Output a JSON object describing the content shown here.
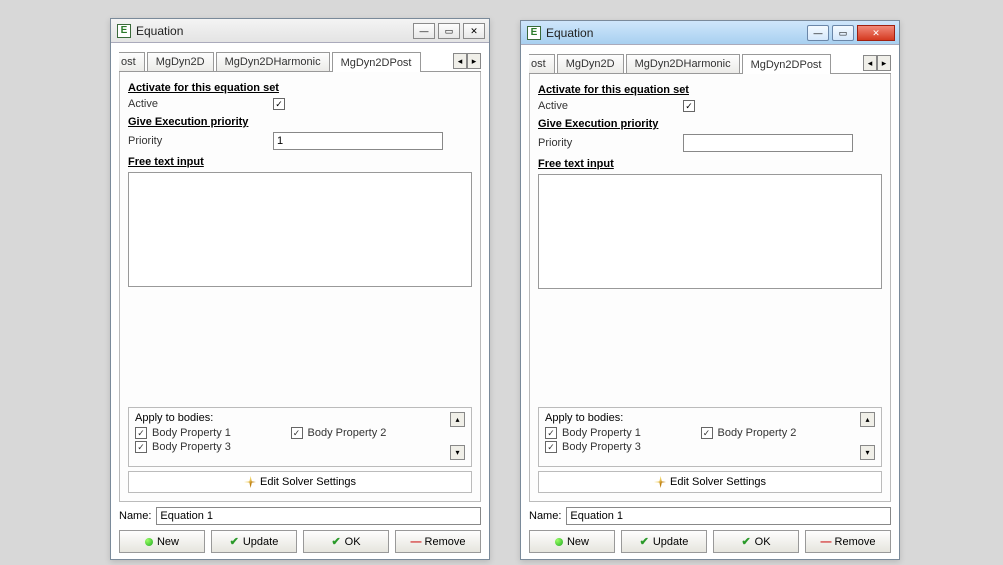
{
  "left": {
    "title": "Equation",
    "tabs": {
      "partial": "ost",
      "t1": "MgDyn2D",
      "t2": "MgDyn2DHarmonic",
      "t3": "MgDyn2DPost"
    },
    "sections": {
      "activate": "Activate for this equation set",
      "activeLabel": "Active",
      "execPriority": "Give Execution priority",
      "priorityLabel": "Priority",
      "priorityValue": "1",
      "freeText": "Free text input"
    },
    "apply": {
      "title": "Apply to bodies:",
      "b1": "Body Property 1",
      "b2": "Body Property 2",
      "b3": "Body Property 3"
    },
    "editSolver": "Edit Solver Settings",
    "nameLabel": "Name:",
    "nameValue": "Equation 1",
    "buttons": {
      "new": "New",
      "update": "Update",
      "ok": "OK",
      "remove": "Remove"
    }
  },
  "right": {
    "title": "Equation",
    "tabs": {
      "partial": "ost",
      "t1": "MgDyn2D",
      "t2": "MgDyn2DHarmonic",
      "t3": "MgDyn2DPost"
    },
    "sections": {
      "activate": "Activate for this equation set",
      "activeLabel": "Active",
      "execPriority": "Give Execution priority",
      "priorityLabel": "Priority",
      "priorityValue": "",
      "freeText": "Free text input"
    },
    "apply": {
      "title": "Apply to bodies:",
      "b1": "Body Property 1",
      "b2": "Body Property 2",
      "b3": "Body Property 3"
    },
    "editSolver": "Edit Solver Settings",
    "nameLabel": "Name:",
    "nameValue": "Equation 1",
    "buttons": {
      "new": "New",
      "update": "Update",
      "ok": "OK",
      "remove": "Remove"
    }
  }
}
